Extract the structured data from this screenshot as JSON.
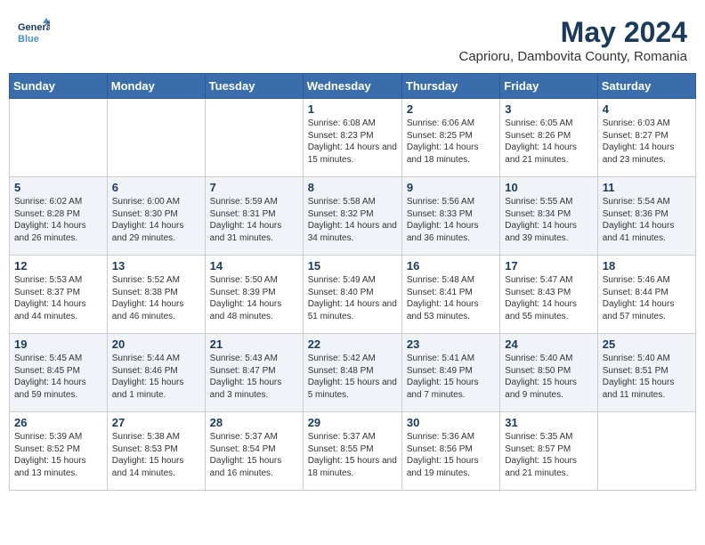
{
  "header": {
    "logo_text_general": "General",
    "logo_text_blue": "Blue",
    "month_title": "May 2024",
    "subtitle": "Caprioru, Dambovita County, Romania"
  },
  "weekdays": [
    "Sunday",
    "Monday",
    "Tuesday",
    "Wednesday",
    "Thursday",
    "Friday",
    "Saturday"
  ],
  "weeks": [
    [
      {
        "day": "",
        "info": ""
      },
      {
        "day": "",
        "info": ""
      },
      {
        "day": "",
        "info": ""
      },
      {
        "day": "1",
        "info": "Sunrise: 6:08 AM\nSunset: 8:23 PM\nDaylight: 14 hours\nand 15 minutes."
      },
      {
        "day": "2",
        "info": "Sunrise: 6:06 AM\nSunset: 8:25 PM\nDaylight: 14 hours\nand 18 minutes."
      },
      {
        "day": "3",
        "info": "Sunrise: 6:05 AM\nSunset: 8:26 PM\nDaylight: 14 hours\nand 21 minutes."
      },
      {
        "day": "4",
        "info": "Sunrise: 6:03 AM\nSunset: 8:27 PM\nDaylight: 14 hours\nand 23 minutes."
      }
    ],
    [
      {
        "day": "5",
        "info": "Sunrise: 6:02 AM\nSunset: 8:28 PM\nDaylight: 14 hours\nand 26 minutes."
      },
      {
        "day": "6",
        "info": "Sunrise: 6:00 AM\nSunset: 8:30 PM\nDaylight: 14 hours\nand 29 minutes."
      },
      {
        "day": "7",
        "info": "Sunrise: 5:59 AM\nSunset: 8:31 PM\nDaylight: 14 hours\nand 31 minutes."
      },
      {
        "day": "8",
        "info": "Sunrise: 5:58 AM\nSunset: 8:32 PM\nDaylight: 14 hours\nand 34 minutes."
      },
      {
        "day": "9",
        "info": "Sunrise: 5:56 AM\nSunset: 8:33 PM\nDaylight: 14 hours\nand 36 minutes."
      },
      {
        "day": "10",
        "info": "Sunrise: 5:55 AM\nSunset: 8:34 PM\nDaylight: 14 hours\nand 39 minutes."
      },
      {
        "day": "11",
        "info": "Sunrise: 5:54 AM\nSunset: 8:36 PM\nDaylight: 14 hours\nand 41 minutes."
      }
    ],
    [
      {
        "day": "12",
        "info": "Sunrise: 5:53 AM\nSunset: 8:37 PM\nDaylight: 14 hours\nand 44 minutes."
      },
      {
        "day": "13",
        "info": "Sunrise: 5:52 AM\nSunset: 8:38 PM\nDaylight: 14 hours\nand 46 minutes."
      },
      {
        "day": "14",
        "info": "Sunrise: 5:50 AM\nSunset: 8:39 PM\nDaylight: 14 hours\nand 48 minutes."
      },
      {
        "day": "15",
        "info": "Sunrise: 5:49 AM\nSunset: 8:40 PM\nDaylight: 14 hours\nand 51 minutes."
      },
      {
        "day": "16",
        "info": "Sunrise: 5:48 AM\nSunset: 8:41 PM\nDaylight: 14 hours\nand 53 minutes."
      },
      {
        "day": "17",
        "info": "Sunrise: 5:47 AM\nSunset: 8:43 PM\nDaylight: 14 hours\nand 55 minutes."
      },
      {
        "day": "18",
        "info": "Sunrise: 5:46 AM\nSunset: 8:44 PM\nDaylight: 14 hours\nand 57 minutes."
      }
    ],
    [
      {
        "day": "19",
        "info": "Sunrise: 5:45 AM\nSunset: 8:45 PM\nDaylight: 14 hours\nand 59 minutes."
      },
      {
        "day": "20",
        "info": "Sunrise: 5:44 AM\nSunset: 8:46 PM\nDaylight: 15 hours\nand 1 minute."
      },
      {
        "day": "21",
        "info": "Sunrise: 5:43 AM\nSunset: 8:47 PM\nDaylight: 15 hours\nand 3 minutes."
      },
      {
        "day": "22",
        "info": "Sunrise: 5:42 AM\nSunset: 8:48 PM\nDaylight: 15 hours\nand 5 minutes."
      },
      {
        "day": "23",
        "info": "Sunrise: 5:41 AM\nSunset: 8:49 PM\nDaylight: 15 hours\nand 7 minutes."
      },
      {
        "day": "24",
        "info": "Sunrise: 5:40 AM\nSunset: 8:50 PM\nDaylight: 15 hours\nand 9 minutes."
      },
      {
        "day": "25",
        "info": "Sunrise: 5:40 AM\nSunset: 8:51 PM\nDaylight: 15 hours\nand 11 minutes."
      }
    ],
    [
      {
        "day": "26",
        "info": "Sunrise: 5:39 AM\nSunset: 8:52 PM\nDaylight: 15 hours\nand 13 minutes."
      },
      {
        "day": "27",
        "info": "Sunrise: 5:38 AM\nSunset: 8:53 PM\nDaylight: 15 hours\nand 14 minutes."
      },
      {
        "day": "28",
        "info": "Sunrise: 5:37 AM\nSunset: 8:54 PM\nDaylight: 15 hours\nand 16 minutes."
      },
      {
        "day": "29",
        "info": "Sunrise: 5:37 AM\nSunset: 8:55 PM\nDaylight: 15 hours\nand 18 minutes."
      },
      {
        "day": "30",
        "info": "Sunrise: 5:36 AM\nSunset: 8:56 PM\nDaylight: 15 hours\nand 19 minutes."
      },
      {
        "day": "31",
        "info": "Sunrise: 5:35 AM\nSunset: 8:57 PM\nDaylight: 15 hours\nand 21 minutes."
      },
      {
        "day": "",
        "info": ""
      }
    ]
  ]
}
